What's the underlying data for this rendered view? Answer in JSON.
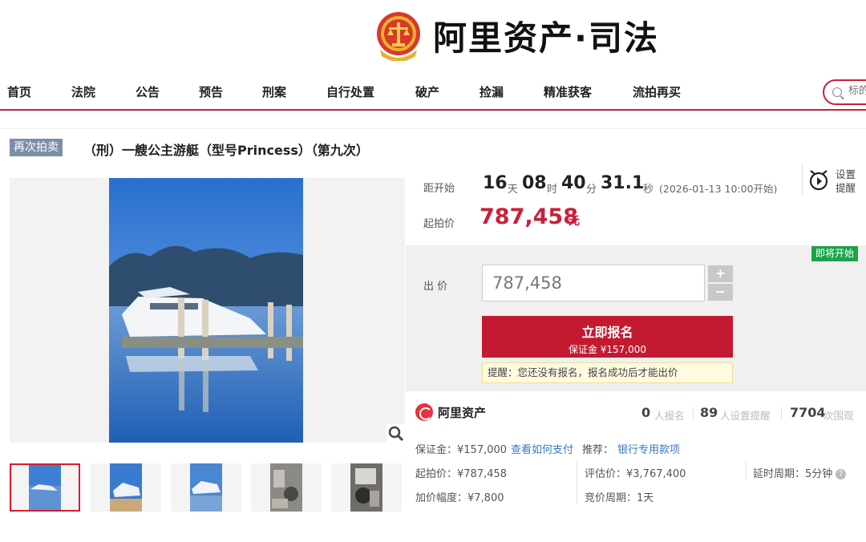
{
  "header": {
    "logo_text": "阿里资产·司法"
  },
  "nav": {
    "items": [
      "首页",
      "法院",
      "公告",
      "预告",
      "刑案",
      "自行处置",
      "破产",
      "捡漏",
      "精准获客",
      "流拍再买"
    ],
    "search_placeholder": "标的"
  },
  "listing": {
    "tag": "再次拍卖",
    "title": "（刑）一艘公主游艇（型号Princess）（第九次）"
  },
  "countdown": {
    "label": "距开始",
    "days": "16",
    "days_unit": "天",
    "hours": "08",
    "hours_unit": "时",
    "minutes": "40",
    "minutes_unit": "分",
    "seconds": "31.1",
    "seconds_unit": "秒",
    "start_note": "(2026-01-13 10:00开始)"
  },
  "reminder": {
    "line1": "设置",
    "line2": "提醒"
  },
  "start_price": {
    "label": "起拍价",
    "value": "787,458",
    "unit": "元"
  },
  "bid": {
    "status_badge": "即将开始",
    "label": "出 价",
    "value": "787,458",
    "plus": "+",
    "minus": "−",
    "signup_label": "立即报名",
    "deposit_line": "保证金 ¥157,000",
    "notice": "提醒：您还没有报名，报名成功后才能出价"
  },
  "stats": {
    "brand": "阿里资产",
    "signup_count": "0",
    "signup_text": "人报名",
    "remind_count": "89",
    "remind_text": "人设置提醒",
    "view_count": "7704",
    "view_text": "次围观"
  },
  "details": {
    "deposit": "保证金：¥157,000",
    "how_to_pay": "查看如何支付",
    "recommend_label": "推荐：",
    "recommend_link": "银行专用款项",
    "start_price": "起拍价：¥787,458",
    "appraisal": "评估价：¥3,767,400",
    "delay": "延时周期：5分钟",
    "increment": "加价幅度：¥7,800",
    "cycle": "竞价周期：1天"
  },
  "colors": {
    "brand_red": "#c8203c",
    "button_red": "#c31a31",
    "badge_green": "#1ba34a",
    "link_blue": "#3a78c3"
  }
}
